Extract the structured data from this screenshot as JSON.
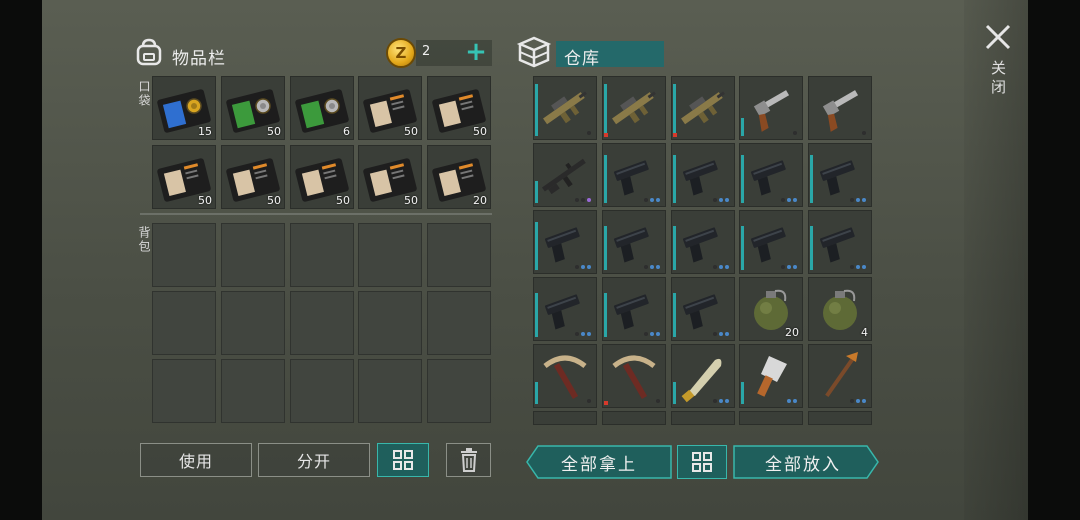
{
  "inventory": {
    "title": "物品栏",
    "coin_count": "2",
    "coin_symbol": "Z",
    "pocket_label": "口袋",
    "backpack_label": "背包",
    "pocket_items": [
      {
        "icon": "id-card-blue-badge",
        "qty": "15"
      },
      {
        "icon": "id-card-green-badge",
        "qty": "50"
      },
      {
        "icon": "id-card-green-badge",
        "qty": "6"
      },
      {
        "icon": "notebook-orange",
        "qty": "50"
      },
      {
        "icon": "notebook-orange",
        "qty": "50"
      },
      {
        "icon": "notebook-orange",
        "qty": "50"
      },
      {
        "icon": "notebook-orange",
        "qty": "50"
      },
      {
        "icon": "notebook-orange",
        "qty": "50"
      },
      {
        "icon": "notebook-orange",
        "qty": "50"
      },
      {
        "icon": "notebook-orange",
        "qty": "20"
      }
    ],
    "buttons": {
      "use": "使用",
      "split": "分开"
    }
  },
  "warehouse": {
    "title": "仓库",
    "items": [
      {
        "icon": "assault-rifle-tan",
        "qty": ""
      },
      {
        "icon": "assault-rifle-tan",
        "qty": ""
      },
      {
        "icon": "assault-rifle-tan",
        "qty": ""
      },
      {
        "icon": "revolver",
        "qty": ""
      },
      {
        "icon": "revolver",
        "qty": ""
      },
      {
        "icon": "m16-rifle",
        "qty": ""
      },
      {
        "icon": "pistol",
        "qty": ""
      },
      {
        "icon": "pistol",
        "qty": ""
      },
      {
        "icon": "pistol",
        "qty": ""
      },
      {
        "icon": "pistol",
        "qty": ""
      },
      {
        "icon": "pistol",
        "qty": ""
      },
      {
        "icon": "pistol",
        "qty": ""
      },
      {
        "icon": "pistol",
        "qty": ""
      },
      {
        "icon": "pistol",
        "qty": ""
      },
      {
        "icon": "pistol",
        "qty": ""
      },
      {
        "icon": "pistol",
        "qty": ""
      },
      {
        "icon": "pistol",
        "qty": ""
      },
      {
        "icon": "pistol",
        "qty": ""
      },
      {
        "icon": "grenade",
        "qty": "20"
      },
      {
        "icon": "grenade",
        "qty": "4"
      },
      {
        "icon": "pickaxe",
        "qty": ""
      },
      {
        "icon": "pickaxe",
        "qty": ""
      },
      {
        "icon": "machete",
        "qty": ""
      },
      {
        "icon": "cleaver",
        "qty": ""
      },
      {
        "icon": "hoe",
        "qty": ""
      }
    ],
    "buttons": {
      "take_all": "全部拿上",
      "put_all": "全部放入"
    }
  },
  "close_label": "关闭",
  "colors": {
    "accent": "#2aa7a8",
    "warehouse_title_bg": "#24696a",
    "rarity_blue": "#4a88c8",
    "rarity_purple": "#9a6ad8",
    "damage_red": "#d63a2c"
  }
}
